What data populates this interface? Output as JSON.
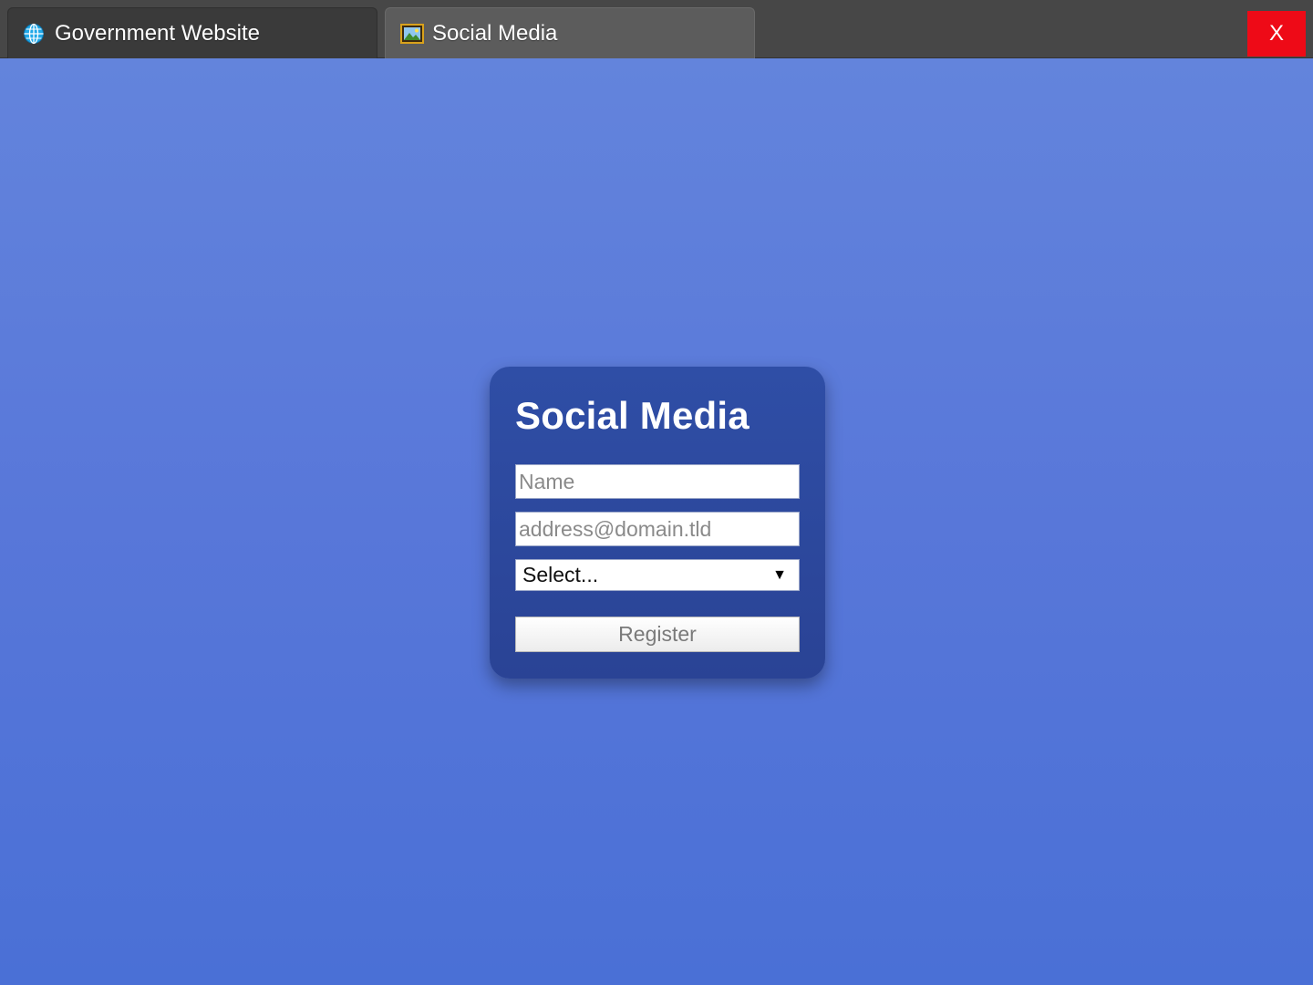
{
  "tabs": [
    {
      "label": "Government Website",
      "icon": "globe-icon",
      "active": false
    },
    {
      "label": "Social Media",
      "icon": "picture-icon",
      "active": true
    }
  ],
  "window": {
    "close_label": "X",
    "close_color": "#ee0a17"
  },
  "page": {
    "background_top": "#6384dc",
    "background_bottom": "#4a70d6"
  },
  "form": {
    "title": "Social Media",
    "name_placeholder": "Name",
    "email_placeholder": "address@domain.tld",
    "select_value": "Select...",
    "register_label": "Register"
  }
}
